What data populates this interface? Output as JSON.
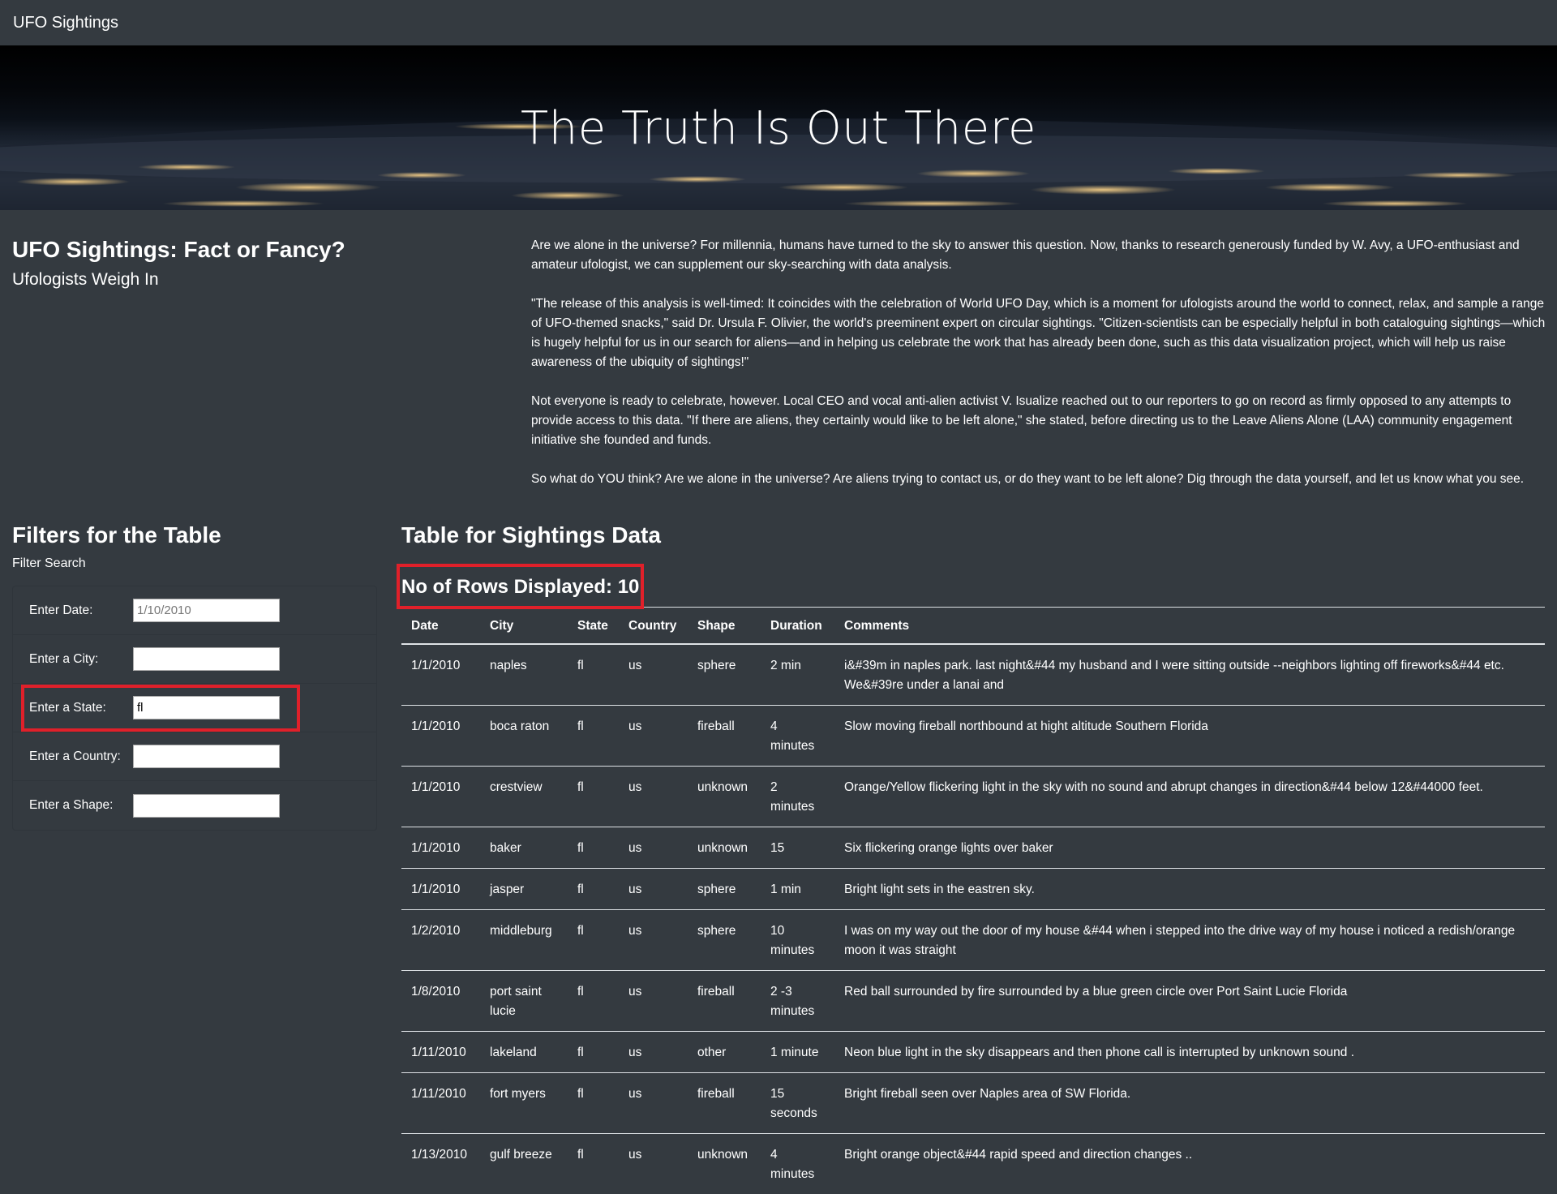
{
  "navbar": {
    "brand": "UFO Sightings"
  },
  "hero": {
    "title": "The Truth Is Out There"
  },
  "intro": {
    "heading": "UFO Sightings: Fact or Fancy?",
    "subheading": "Ufologists Weigh In",
    "paragraphs": [
      "Are we alone in the universe? For millennia, humans have turned to the sky to answer this question. Now, thanks to research generously funded by W. Avy, a UFO-enthusiast and amateur ufologist, we can supplement our sky-searching with data analysis.",
      "\"The release of this analysis is well-timed: It coincides with the celebration of World UFO Day, which is a moment for ufologists around the world to connect, relax, and sample a range of UFO-themed snacks,\" said Dr. Ursula F. Olivier, the world's preeminent expert on circular sightings. \"Citizen-scientists can be especially helpful in both cataloguing sightings—which is hugely helpful for us in our search for aliens—and in helping us celebrate the work that has already been done, such as this data visualization project, which will help us raise awareness of the ubiquity of sightings!\"",
      "Not everyone is ready to celebrate, however. Local CEO and vocal anti-alien activist V. Isualize reached out to our reporters to go on record as firmly opposed to any attempts to provide access to this data. \"If there are aliens, they certainly would like to be left alone,\" she stated, before directing us to the Leave Aliens Alone (LAA) community engagement initiative she founded and funds.",
      "So what do YOU think? Are we alone in the universe? Are aliens trying to contact us, or do they want to be left alone? Dig through the data yourself, and let us know what you see."
    ]
  },
  "filters": {
    "heading": "Filters for the Table",
    "subheading": "Filter Search",
    "items": [
      {
        "label": "Enter Date:",
        "value": "",
        "placeholder": "1/10/2010"
      },
      {
        "label": "Enter a City:",
        "value": "",
        "placeholder": ""
      },
      {
        "label": "Enter a State:",
        "value": "fl",
        "placeholder": ""
      },
      {
        "label": "Enter a Country:",
        "value": "",
        "placeholder": ""
      },
      {
        "label": "Enter a Shape:",
        "value": "",
        "placeholder": ""
      }
    ]
  },
  "table": {
    "heading": "Table for Sightings Data",
    "row_count_label": "No of Rows Displayed: 10",
    "columns": [
      "Date",
      "City",
      "State",
      "Country",
      "Shape",
      "Duration",
      "Comments"
    ],
    "rows": [
      [
        "1/1/2010",
        "naples",
        "fl",
        "us",
        "sphere",
        "2 min",
        "i&#39m in naples park. last night&#44 my husband and I were sitting outside --neighbors lighting off fireworks&#44 etc. We&#39re under a lanai and"
      ],
      [
        "1/1/2010",
        "boca raton",
        "fl",
        "us",
        "fireball",
        "4 minutes",
        "Slow moving fireball northbound at hight altitude Southern Florida"
      ],
      [
        "1/1/2010",
        "crestview",
        "fl",
        "us",
        "unknown",
        "2 minutes",
        "Orange/Yellow flickering light in the sky with no sound and abrupt changes in direction&#44 below 12&#44000 feet."
      ],
      [
        "1/1/2010",
        "baker",
        "fl",
        "us",
        "unknown",
        "15",
        "Six flickering orange lights over baker"
      ],
      [
        "1/1/2010",
        "jasper",
        "fl",
        "us",
        "sphere",
        "1 min",
        "Bright light sets in the eastren sky."
      ],
      [
        "1/2/2010",
        "middleburg",
        "fl",
        "us",
        "sphere",
        "10 minutes",
        "I was on my way out the door of my house &#44 when i stepped into the drive way of my house i noticed a redish/orange moon it was straight"
      ],
      [
        "1/8/2010",
        "port saint lucie",
        "fl",
        "us",
        "fireball",
        "2 -3 minutes",
        "Red ball surrounded by fire surrounded by a blue green circle over Port Saint Lucie Florida"
      ],
      [
        "1/11/2010",
        "lakeland",
        "fl",
        "us",
        "other",
        "1 minute",
        "Neon blue light in the sky disappears and then phone call is interrupted by unknown sound ."
      ],
      [
        "1/11/2010",
        "fort myers",
        "fl",
        "us",
        "fireball",
        "15 seconds",
        "Bright fireball seen over Naples area of SW Florida."
      ],
      [
        "1/13/2010",
        "gulf breeze",
        "fl",
        "us",
        "unknown",
        "4 minutes",
        "Bright orange object&#44 rapid speed and direction changes .."
      ]
    ]
  },
  "colors": {
    "page_background": "#343a40",
    "highlight_border": "#e0202a",
    "text": "#ffffff"
  }
}
